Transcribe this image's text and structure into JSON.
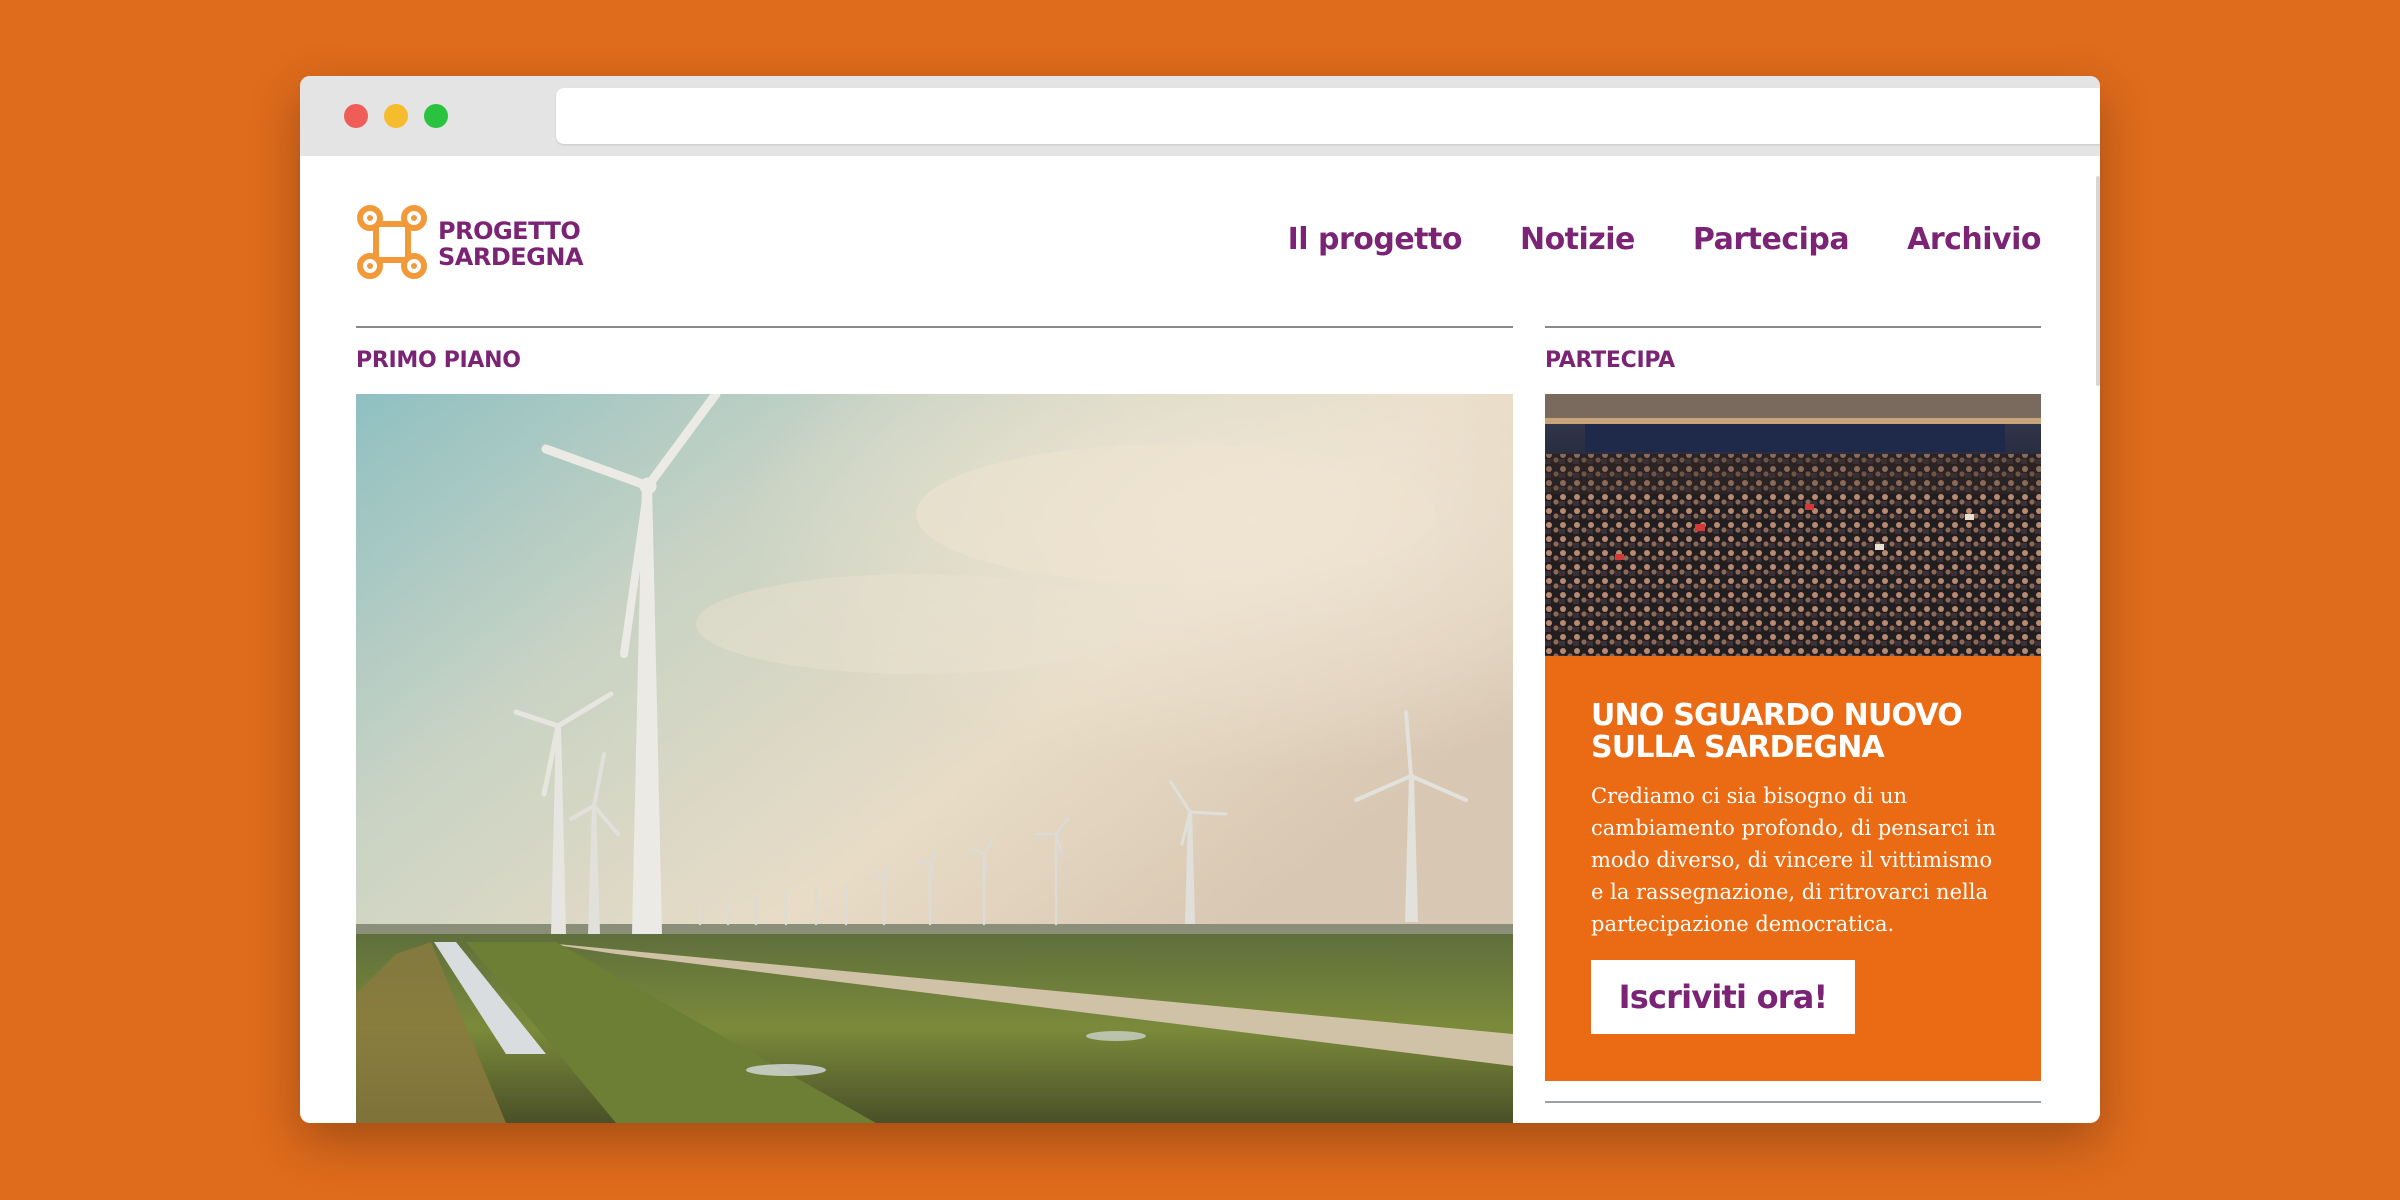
{
  "browser": {
    "url": ""
  },
  "site": {
    "logo_line1": "PROGETTO",
    "logo_line2": "SARDEGNA"
  },
  "nav": {
    "items": [
      {
        "label": "Il progetto"
      },
      {
        "label": "Notizie"
      },
      {
        "label": "Partecipa"
      },
      {
        "label": "Archivio"
      }
    ]
  },
  "main": {
    "section_label": "PRIMO PIANO",
    "hero_image": "wind-turbines-field-photo"
  },
  "sidebar": {
    "section_label": "PARTECIPA",
    "photo": "crowd-auditorium-photo",
    "card_title": "UNO SGUARDO NUOVO SULLA SARDEGNA",
    "card_body": "Crediamo ci sia bisogno di un cambiamento profondo, di pensarci in modo diverso, di vincere il vittimismo e la rassegnazione, di ritrovarci nella partecipazione democratica.",
    "cta_label": "Iscriviti ora!"
  },
  "colors": {
    "background": "#df6b1c",
    "brand_purple": "#7b2475",
    "brand_orange": "#ea6b13",
    "logo_orange": "#f29a3a"
  }
}
